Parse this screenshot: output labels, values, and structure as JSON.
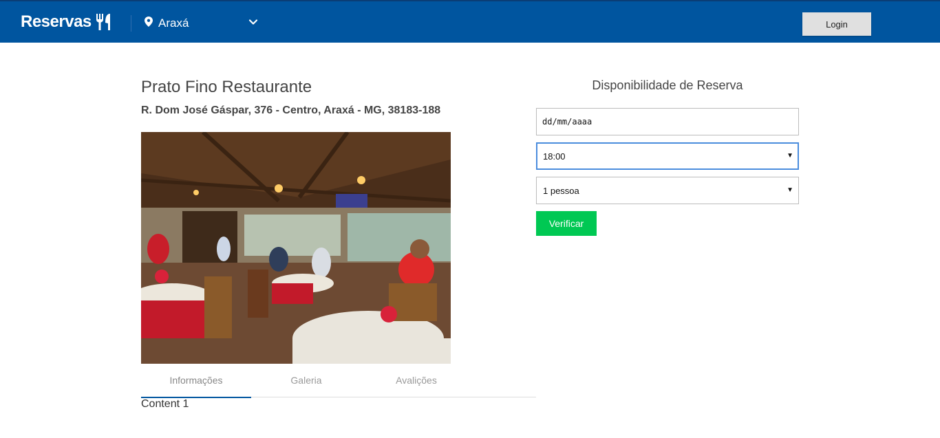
{
  "header": {
    "brand": "Reservas",
    "city": "Araxá",
    "login_label": "Login"
  },
  "restaurant": {
    "name": "Prato Fino Restaurante",
    "address": "R. Dom José Gáspar, 376 - Centro, Araxá - MG, 38183-188"
  },
  "tabs": [
    {
      "label": "Informações",
      "active": true
    },
    {
      "label": "Galeria",
      "active": false
    },
    {
      "label": "Avalições",
      "active": false
    }
  ],
  "tab_content": "Content 1",
  "reservation": {
    "title": "Disponibilidade de Reserva",
    "date_placeholder": "dd/mm/aaaa",
    "time_value": "18:00",
    "people_value": "1 pessoa",
    "verify_label": "Verificar"
  },
  "colors": {
    "header_bg": "#00559f",
    "accent_green": "#00c853",
    "tab_active": "#00559f"
  },
  "icons": [
    "utensils-icon",
    "map-pin-icon",
    "chevron-down-icon",
    "select-caret-icon"
  ]
}
